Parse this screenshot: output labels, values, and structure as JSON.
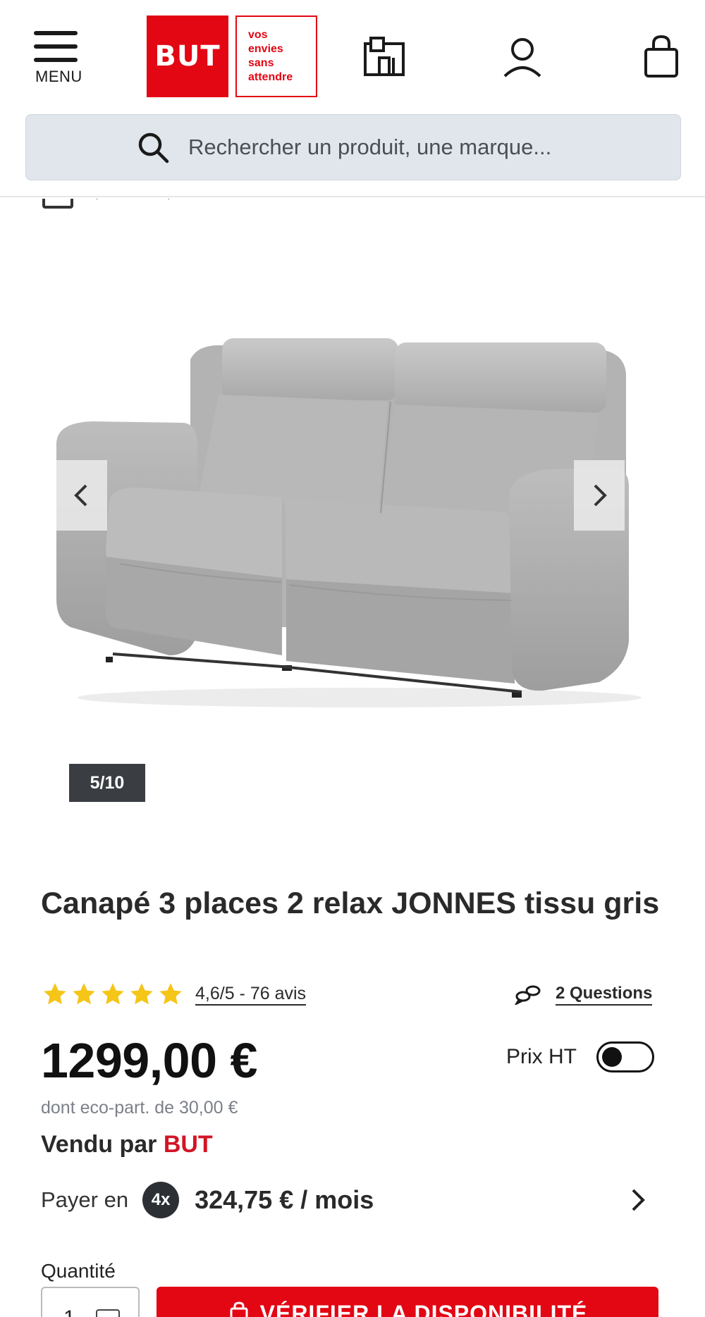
{
  "header": {
    "menu_label": "MENU",
    "logo_text": "BUT",
    "tagline": [
      "vos",
      "envies",
      "sans",
      "attendre"
    ],
    "icons": [
      "store-icon",
      "account-icon",
      "cart-icon"
    ]
  },
  "search": {
    "placeholder": "Rechercher un produit, une marque..."
  },
  "gallery": {
    "counter": "5/10",
    "icons": [
      "chevron-left-icon",
      "chevron-right-icon"
    ]
  },
  "product": {
    "title": "Canapé 3 places 2 relax JONNES tissu gris",
    "rating_value": 4.6,
    "rating_stars": 5,
    "rating_text": "4,6/5 - 76 avis",
    "questions_label": "2 Questions",
    "price": "1299,00 €",
    "prix_ht_label": "Prix HT",
    "prix_ht_enabled": false,
    "eco_part": "dont eco-part. de 30,00 €",
    "sold_by_prefix": "Vendu par",
    "sold_by_seller": "BUT",
    "installment": {
      "prefix": "Payer en",
      "badge": "4x",
      "amount": "324,75 € / mois"
    },
    "quantity_label": "Quantité",
    "quantity_value": "1",
    "cta_label": "VÉRIFIER LA DISPONIBILITÉ"
  },
  "colors": {
    "brand_red": "#e30613",
    "search_bg": "#e1e6ec",
    "star_yellow": "#f5c518",
    "counter_bg": "#3a3d42"
  }
}
